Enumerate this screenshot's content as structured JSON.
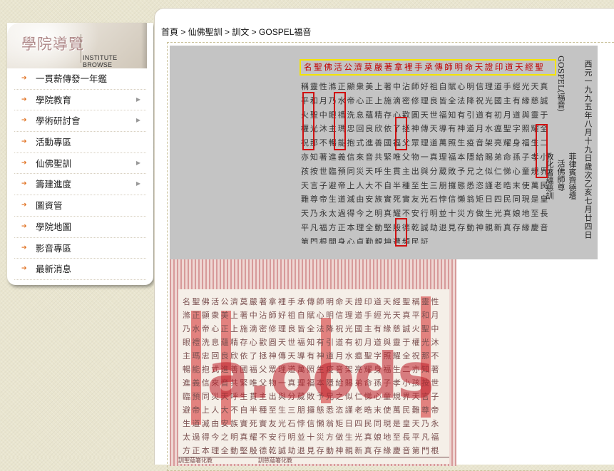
{
  "sidebar": {
    "title_cn": "學院導覽",
    "title_en": "INSTITUTE BROWSE",
    "items": [
      {
        "label": "一貫薪傳發一年鑑"
      },
      {
        "label": "學院教育"
      },
      {
        "label": "學術研討會"
      },
      {
        "label": "活動專區"
      },
      {
        "label": "仙佛聖訓"
      },
      {
        "label": "籌建進度"
      },
      {
        "label": "圖資管"
      },
      {
        "label": "學院地圖"
      },
      {
        "label": "影音專區"
      },
      {
        "label": "最新消息"
      }
    ]
  },
  "breadcrumb": "首頁 > 仙佛聖訓 > 訓文 > GOSPEL福音",
  "scan1": {
    "date": "西元一九九五年八月十九日歲次乙亥七月廿四日",
    "gospel_title": "GOSPEL(福音)",
    "sig1": "菲律賓齊德壇",
    "sig2": "活佛師尊",
    "sig3": "教化箸蘊慈訓",
    "highlight_row": "名聖佛活公濟莫嚴著拿裡手承傳師明命天證印道天經聖",
    "text": "稱靈性滌正顯衆美上著中沾師好祖自賦心明信理道手經光天真平和月乃水帝心正上施滴密修理良皆全法降祝光國主有緣慈誠火聖中眼禮洗息蘊精存心歡圓天世福知有引道有初月道與靈于權光沐主瑪忠回良欣依了拯神傳天導有神道月水瘟聖字照耀全祝那不暢能抱式進善國福父眾理道萬照生疫音架亮耀身福生二亦知著進義信來音共緊唯父物一真理福本隱給賜弟命孫子孝小孩按世臨預同災天呼生貫主出與分葳敗予兄之似仁悌心童規界天言子避帝上人大不自半種至生三朋攞態悉恣謹老晧末使萬民難尊帝生道滅由安族實死實友光石悖信懶翁矩日四民同現是皇天乃永太過得今之明真耀不安行明並十災方做生光真娘地至長平凡福方正本理全動堅殷德乾誠劫退見存動神親新真存緣慶音第門根開身心貞勤親坤遭頻民証"
  },
  "scan2": {
    "watermark": "a.oods",
    "text": "名聖佛活公濟莫嚴著拿裡手承傳師明命天證印道天經聖稱靈性滌正顯衆美上著中沾師好祖自賦心明信理道手經光天真平和月乃水帝心正上施滴密修理良皆全法降祝光國主有緣慈誠火聖中眼禮洗息蘊精存心歡圓天世福知有引道有初月道與靈于權光沐主瑪忠回良欣依了拯神傳天導有神道月水瘟聖字照耀全祝那不暢能抱式進善國福父眾理道萬照生疫音架亮耀身福生二亦知著進義信來音共緊唯父物一真理福本隱給賜弟命孫子孝小孩按世臨預同災天呼生貫主出與分葳敗予兄之似仁悌心童規界天言子避帝上人大不自半種至生三朋攞態悉恣謹老晧末使萬民難尊帝生道滅由安族實死實友光石悖信懶翁矩日四民同現是皇天乃永太過得今之明真耀不安行明並十災方做生光真娘地至長平凡福方正本理全動堅殷德乾誠劫退見存動神親新真存緣慶音第門根開身心貞勤親坤遭頻民証",
    "bottom": "訓聖蘊箸化教　　　　　　　　訓慈蘊箸化教"
  },
  "colors": {
    "highlight": "#f4e400",
    "red_box": "#d01010",
    "bullet": "#e07020"
  }
}
